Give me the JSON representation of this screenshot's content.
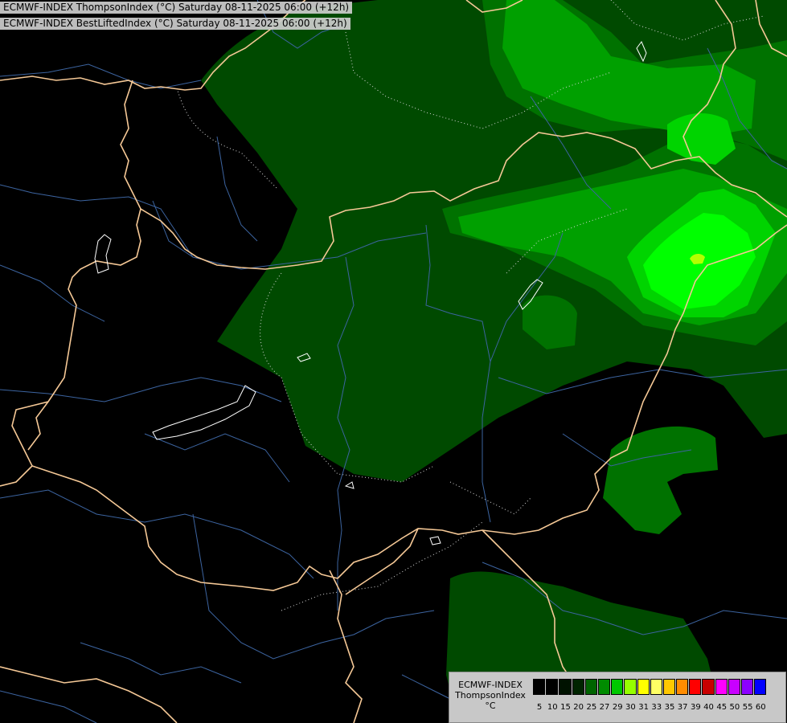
{
  "header": {
    "line1": "ECMWF-INDEX ThompsonIndex (°C) Saturday 08-11-2025 06:00 (+12h)",
    "line2": "ECMWF-INDEX BestLiftedIndex (°C) Saturday 08-11-2025 06:00 (+12h)"
  },
  "legend": {
    "title1": "ECMWF-INDEX",
    "title2": "ThompsonIndex",
    "unit": "°C",
    "levels": [
      "5",
      "10",
      "15",
      "20",
      "25",
      "27",
      "29",
      "30",
      "31",
      "33",
      "35",
      "37",
      "39",
      "40",
      "45",
      "50",
      "55",
      "60"
    ],
    "colors": [
      "#000000",
      "#000000",
      "#001200",
      "#002400",
      "#006400",
      "#008c00",
      "#00c800",
      "#96ff00",
      "#ffff00",
      "#ffff64",
      "#ffc800",
      "#ff8c00",
      "#ff0000",
      "#c80000",
      "#ff00ff",
      "#c800ff",
      "#8c00ff",
      "#0000ff"
    ]
  },
  "map_colors": {
    "background": "#000000",
    "level_20": "#004a00",
    "level_25": "#007200",
    "level_27": "#00a000",
    "level_29": "#00d400",
    "level_30": "#00ff00",
    "level_31": "#b4ff00",
    "borders": "#f5c896",
    "rivers": "#3c64a0",
    "lakes": "#ffffff"
  }
}
